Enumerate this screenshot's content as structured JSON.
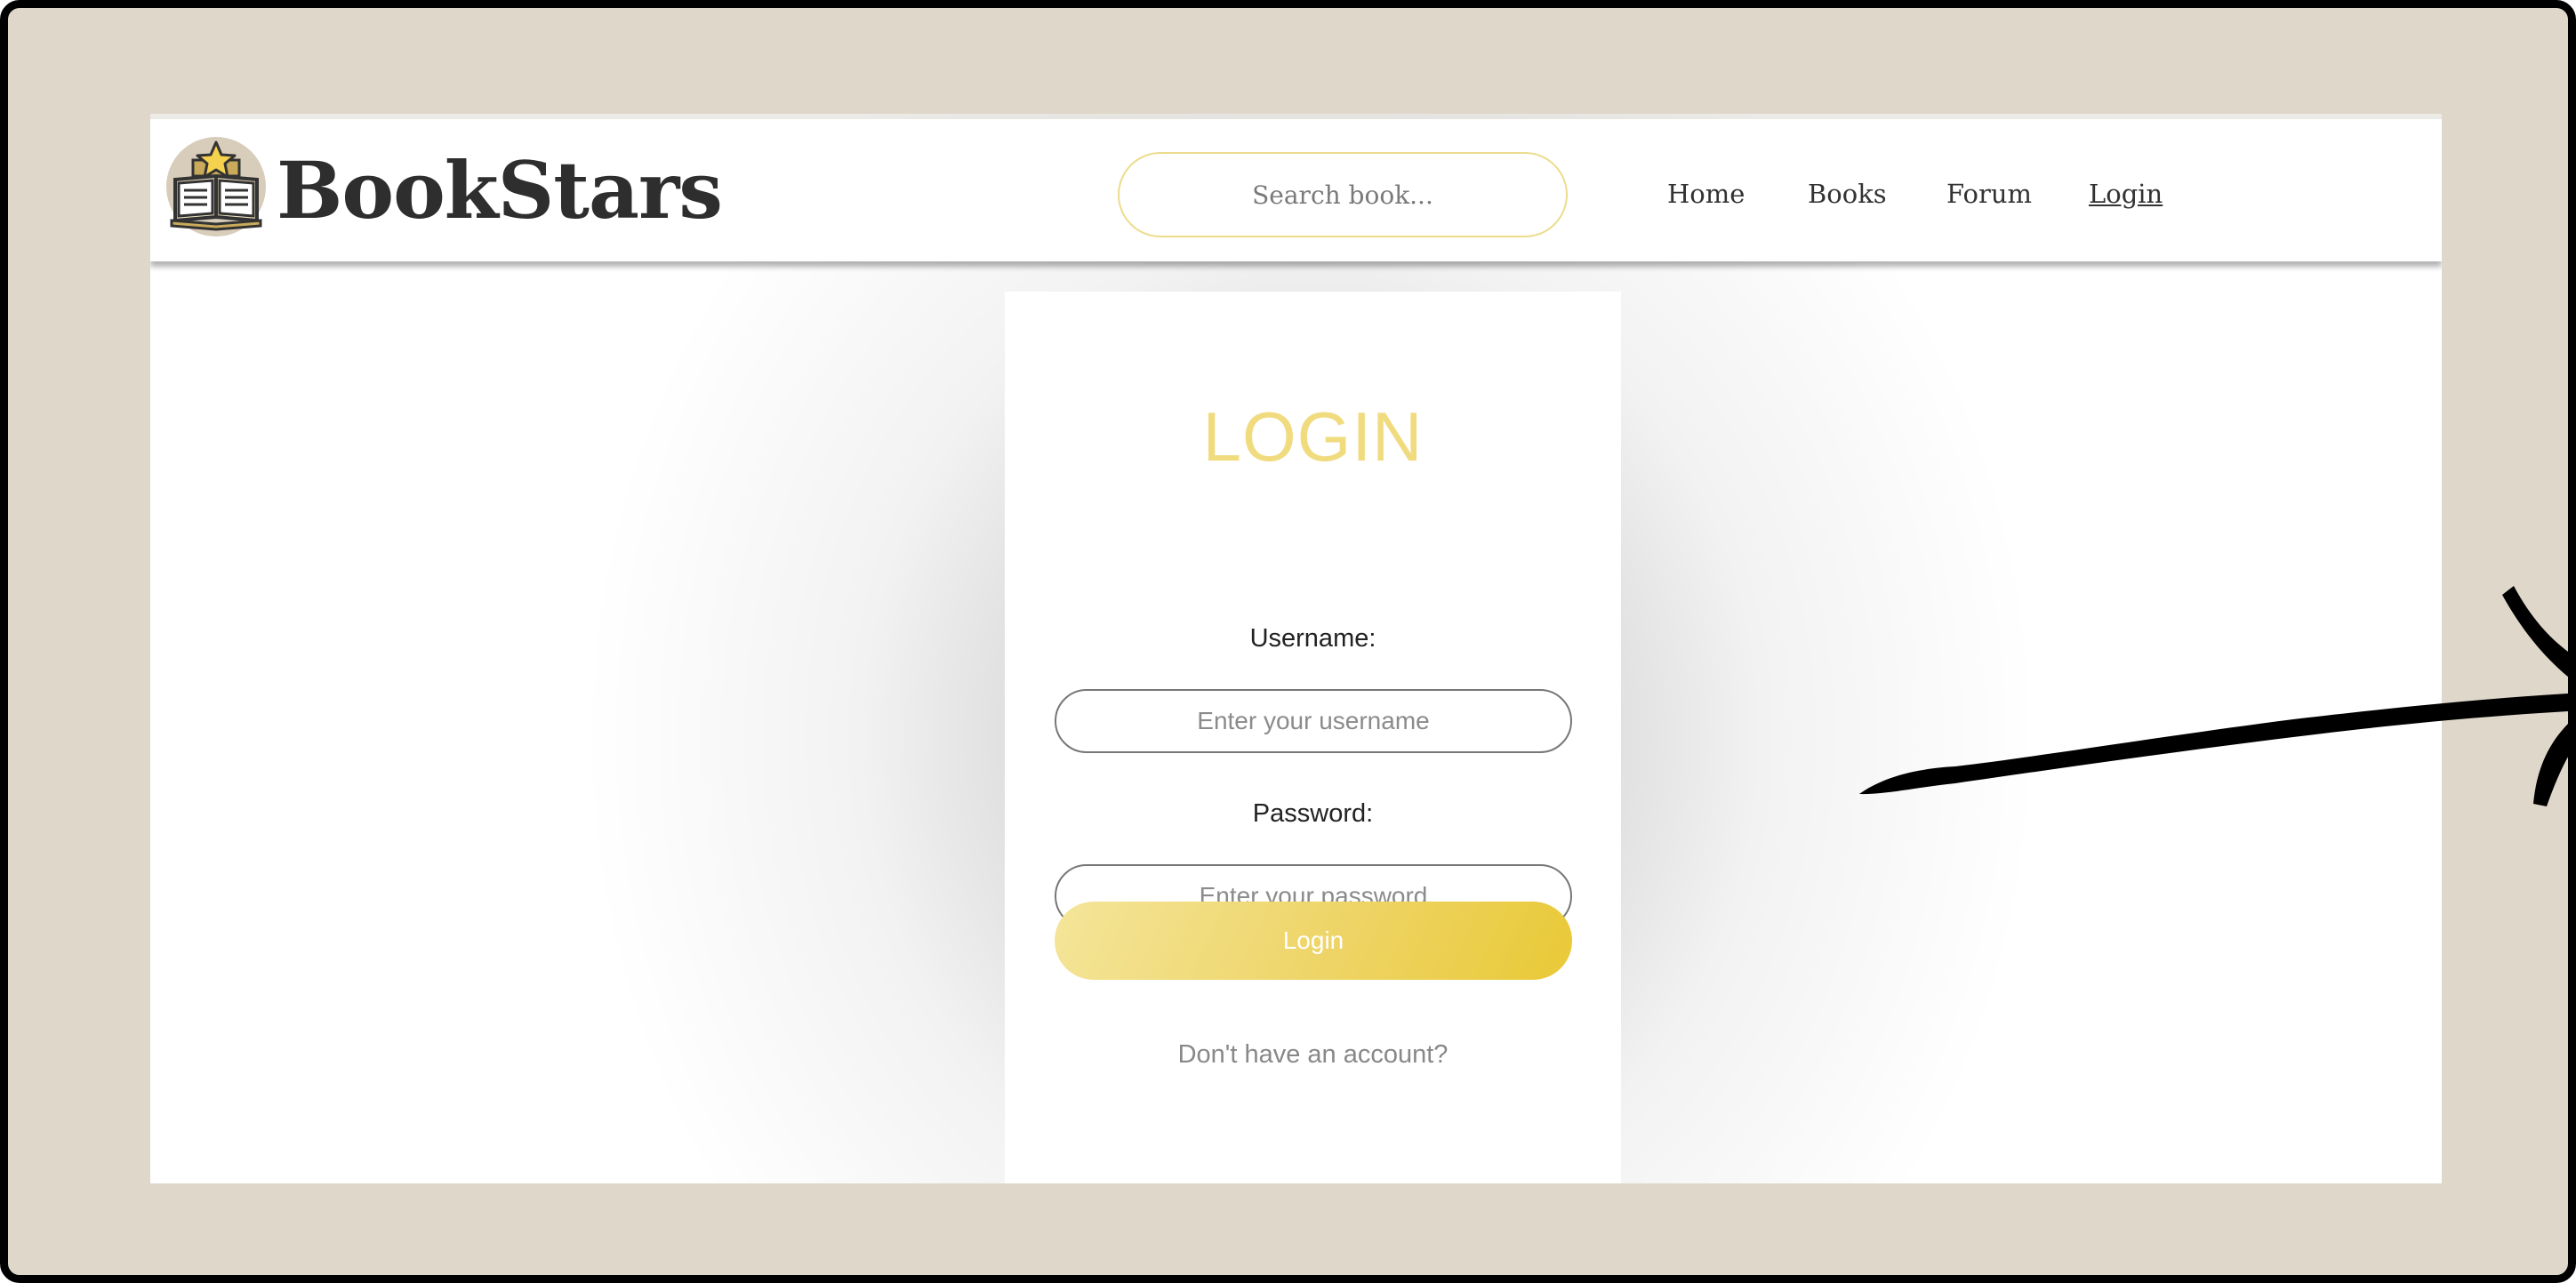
{
  "header": {
    "brand": "BookStars",
    "logo_icon": "book-star-icon",
    "search_placeholder": "Search book...",
    "nav": [
      {
        "label": "Home",
        "active": false
      },
      {
        "label": "Books",
        "active": false
      },
      {
        "label": "Forum",
        "active": false
      },
      {
        "label": "Login",
        "active": true
      }
    ]
  },
  "login": {
    "title": "LOGIN",
    "username_label": "Username:",
    "username_placeholder": "Enter your username",
    "password_label": "Password:",
    "password_placeholder": "Enter your password",
    "button_label": "Login",
    "signup_text": "Don't have an account?"
  },
  "colors": {
    "accent": "#f1db7f",
    "button_gradient_start": "#f4e59a",
    "button_gradient_end": "#e9c936",
    "frame_background": "#dfd7ca"
  },
  "annotation": {
    "icon": "hand-drawn-arrow-icon"
  }
}
